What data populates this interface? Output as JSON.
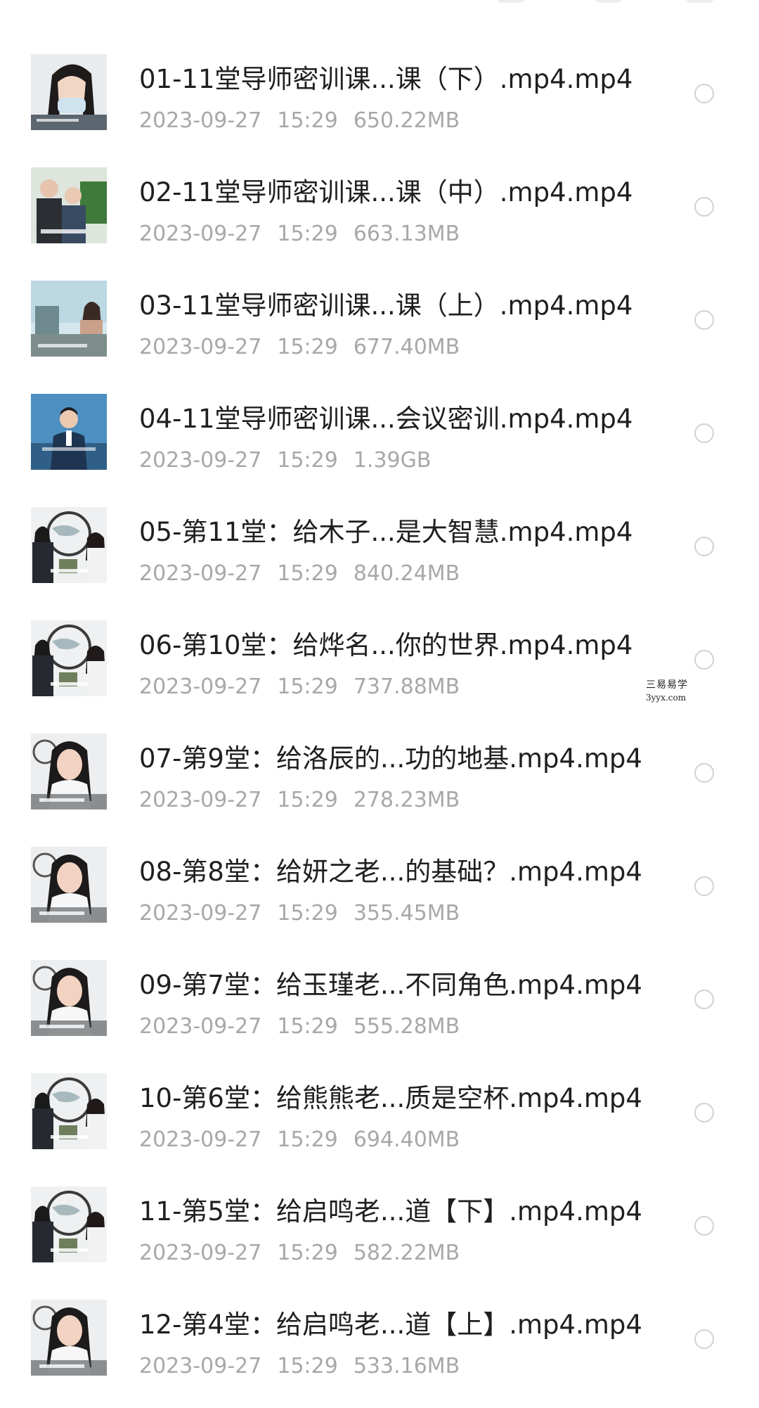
{
  "files": [
    {
      "name": "01-11堂导师密训课...课（下）.mp4.mp4",
      "date": "2023-09-27",
      "time": "15:29",
      "size": "650.22MB",
      "thumb": "portrait-woman"
    },
    {
      "name": "02-11堂导师密训课...课（中）.mp4.mp4",
      "date": "2023-09-27",
      "time": "15:29",
      "size": "663.13MB",
      "thumb": "two-people"
    },
    {
      "name": "03-11堂导师密训课...课（上）.mp4.mp4",
      "date": "2023-09-27",
      "time": "15:29",
      "size": "677.40MB",
      "thumb": "office-seated"
    },
    {
      "name": "04-11堂导师密训课...会议密训.mp4.mp4",
      "date": "2023-09-27",
      "time": "15:29",
      "size": "1.39GB",
      "thumb": "man-center"
    },
    {
      "name": "05-第11堂：给木子...是大智慧.mp4.mp4",
      "date": "2023-09-27",
      "time": "15:29",
      "size": "840.24MB",
      "thumb": "studio-talk"
    },
    {
      "name": "06-第10堂：给烨名...你的世界.mp4.mp4",
      "date": "2023-09-27",
      "time": "15:29",
      "size": "737.88MB",
      "thumb": "studio-talk"
    },
    {
      "name": "07-第9堂：给洛辰的...功的地基.mp4.mp4",
      "date": "2023-09-27",
      "time": "15:29",
      "size": "278.23MB",
      "thumb": "portrait-woman-white"
    },
    {
      "name": "08-第8堂：给妍之老...的基础？.mp4.mp4",
      "date": "2023-09-27",
      "time": "15:29",
      "size": "355.45MB",
      "thumb": "portrait-woman-white"
    },
    {
      "name": "09-第7堂：给玉瑾老...不同角色.mp4.mp4",
      "date": "2023-09-27",
      "time": "15:29",
      "size": "555.28MB",
      "thumb": "portrait-woman-white"
    },
    {
      "name": "10-第6堂：给熊熊老...质是空杯.mp4.mp4",
      "date": "2023-09-27",
      "time": "15:29",
      "size": "694.40MB",
      "thumb": "studio-talk"
    },
    {
      "name": "11-第5堂：给启鸣老...道【下】.mp4.mp4",
      "date": "2023-09-27",
      "time": "15:29",
      "size": "582.22MB",
      "thumb": "studio-talk"
    },
    {
      "name": "12-第4堂：给启鸣老...道【上】.mp4.mp4",
      "date": "2023-09-27",
      "time": "15:29",
      "size": "533.16MB",
      "thumb": "portrait-woman-white"
    }
  ],
  "watermark": {
    "line1": "三易易学",
    "line2": "3yyx.com"
  }
}
